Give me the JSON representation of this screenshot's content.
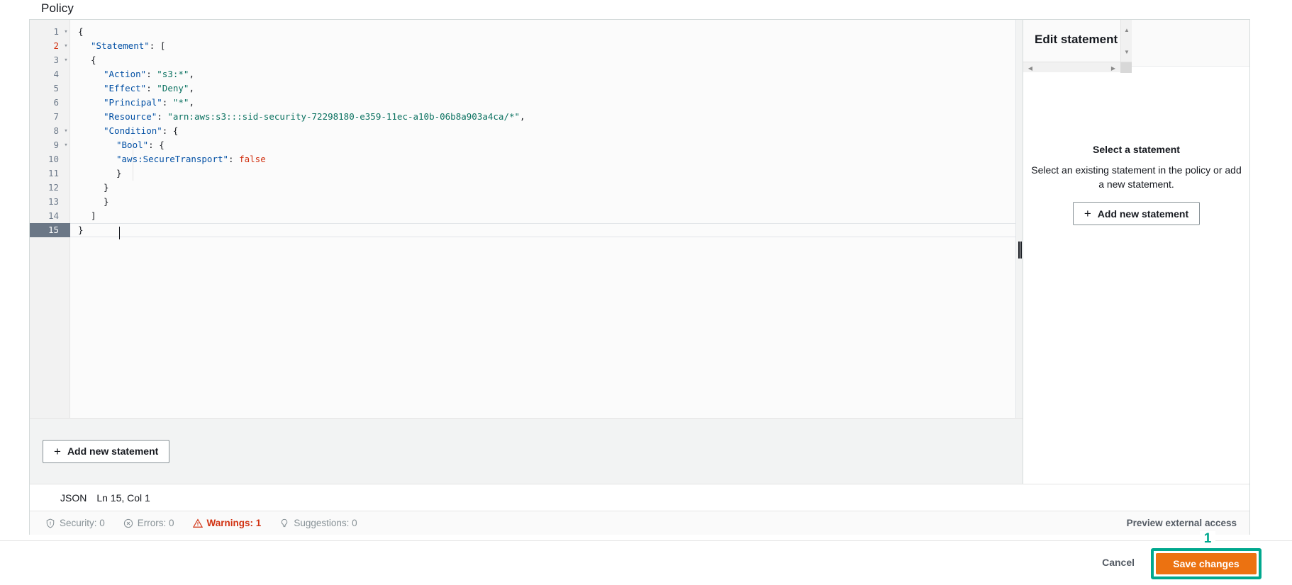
{
  "page": {
    "heading": "Policy"
  },
  "editor": {
    "language_label": "JSON",
    "cursor_position": "Ln 15, Col 1",
    "active_line": 15,
    "warning_line": 2,
    "add_statement_label": "Add new statement",
    "plus_icon": "plus-icon",
    "lines": [
      {
        "n": 1,
        "fold": true,
        "indent": 0,
        "tokens": [
          {
            "t": "pun",
            "v": "{"
          }
        ]
      },
      {
        "n": 2,
        "fold": true,
        "indent": 1,
        "tokens": [
          {
            "t": "key",
            "v": "\"Statement\""
          },
          {
            "t": "pun",
            "v": ": ["
          }
        ]
      },
      {
        "n": 3,
        "fold": true,
        "indent": 1,
        "tokens": [
          {
            "t": "pun",
            "v": "{"
          }
        ]
      },
      {
        "n": 4,
        "fold": false,
        "indent": 2,
        "tokens": [
          {
            "t": "key",
            "v": "\"Action\""
          },
          {
            "t": "pun",
            "v": ": "
          },
          {
            "t": "str",
            "v": "\"s3:*\""
          },
          {
            "t": "pun",
            "v": ","
          }
        ]
      },
      {
        "n": 5,
        "fold": false,
        "indent": 2,
        "tokens": [
          {
            "t": "key",
            "v": "\"Effect\""
          },
          {
            "t": "pun",
            "v": ": "
          },
          {
            "t": "str",
            "v": "\"Deny\""
          },
          {
            "t": "pun",
            "v": ","
          }
        ]
      },
      {
        "n": 6,
        "fold": false,
        "indent": 2,
        "tokens": [
          {
            "t": "key",
            "v": "\"Principal\""
          },
          {
            "t": "pun",
            "v": ": "
          },
          {
            "t": "str",
            "v": "\"*\""
          },
          {
            "t": "pun",
            "v": ","
          }
        ]
      },
      {
        "n": 7,
        "fold": false,
        "indent": 2,
        "tokens": [
          {
            "t": "key",
            "v": "\"Resource\""
          },
          {
            "t": "pun",
            "v": ": "
          },
          {
            "t": "str",
            "v": "\"arn:aws:s3:::sid-security-72298180-e359-11ec-a10b-06b8a903a4ca/*\""
          },
          {
            "t": "pun",
            "v": ","
          }
        ]
      },
      {
        "n": 8,
        "fold": true,
        "indent": 2,
        "tokens": [
          {
            "t": "key",
            "v": "\"Condition\""
          },
          {
            "t": "pun",
            "v": ": {"
          }
        ]
      },
      {
        "n": 9,
        "fold": true,
        "indent": 3,
        "tokens": [
          {
            "t": "key",
            "v": "\"Bool\""
          },
          {
            "t": "pun",
            "v": ": {"
          }
        ]
      },
      {
        "n": 10,
        "fold": false,
        "indent": 3,
        "tokens": [
          {
            "t": "key",
            "v": "\"aws:SecureTransport\""
          },
          {
            "t": "pun",
            "v": ": "
          },
          {
            "t": "bool",
            "v": "false"
          }
        ]
      },
      {
        "n": 11,
        "fold": false,
        "indent": 3,
        "tokens": [
          {
            "t": "pun",
            "v": "}"
          }
        ]
      },
      {
        "n": 12,
        "fold": false,
        "indent": 2,
        "tokens": [
          {
            "t": "pun",
            "v": "}"
          }
        ]
      },
      {
        "n": 13,
        "fold": false,
        "indent": 2,
        "tokens": [
          {
            "t": "pun",
            "v": "}"
          }
        ]
      },
      {
        "n": 14,
        "fold": false,
        "indent": 1,
        "tokens": [
          {
            "t": "pun",
            "v": "]"
          }
        ]
      },
      {
        "n": 15,
        "fold": false,
        "indent": 0,
        "tokens": [
          {
            "t": "pun",
            "v": "}"
          }
        ]
      }
    ]
  },
  "side_panel": {
    "title": "Edit statement",
    "empty_title": "Select a statement",
    "empty_description": "Select an existing statement in the policy or add a new statement.",
    "add_statement_label": "Add new statement",
    "scroll_up_icon": "chevron-up-icon",
    "scroll_down_icon": "chevron-down-icon",
    "scroll_left_icon": "chevron-left-icon",
    "scroll_right_icon": "chevron-right-icon"
  },
  "findings": [
    {
      "id": "security",
      "icon": "shield-icon",
      "label": "Security: 0",
      "alert": false
    },
    {
      "id": "errors",
      "icon": "error-circle-icon",
      "label": "Errors: 0",
      "alert": false
    },
    {
      "id": "warnings",
      "icon": "warning-triangle-icon",
      "label": "Warnings: 1",
      "alert": true
    },
    {
      "id": "suggestions",
      "icon": "lightbulb-icon",
      "label": "Suggestions: 0",
      "alert": false
    }
  ],
  "preview_link": "Preview external access",
  "footer": {
    "cancel_label": "Cancel",
    "save_label": "Save changes"
  },
  "annotation": {
    "step_number": "1",
    "highlight_color": "#00a88e"
  },
  "colors": {
    "accent_orange": "#ec7211",
    "alert_red": "#d13212",
    "teal_highlight": "#00a88e"
  }
}
